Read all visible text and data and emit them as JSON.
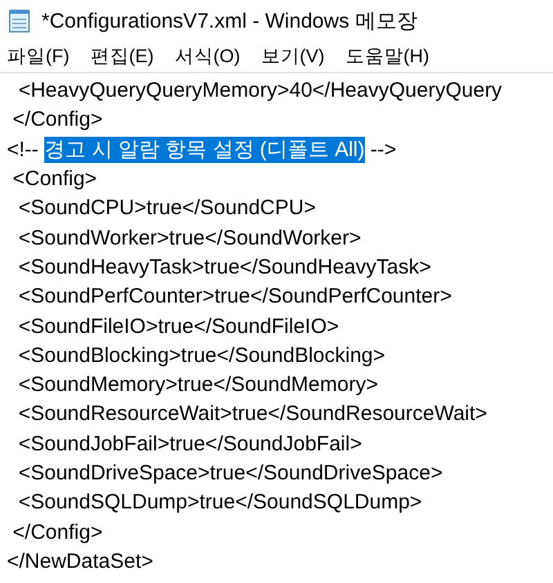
{
  "window": {
    "title": "*ConfigurationsV7.xml - Windows 메모장"
  },
  "menu": [
    "파일(F)",
    "편집(E)",
    "서식(O)",
    "보기(V)",
    "도움말(H)"
  ],
  "editor": {
    "lines": [
      [
        {
          "text": "  <HeavyQueryQueryMemory>40</HeavyQueryQuery",
          "selected": false
        }
      ],
      [
        {
          "text": " </Config>",
          "selected": false
        }
      ],
      [
        {
          "text": "<!-- ",
          "selected": false
        },
        {
          "text": "경고 시 알람 항목 설정 (디폴트 All)",
          "selected": true
        },
        {
          "text": " -->",
          "selected": false
        }
      ],
      [
        {
          "text": " <Config>",
          "selected": false
        }
      ],
      [
        {
          "text": "  <SoundCPU>true</SoundCPU>",
          "selected": false
        }
      ],
      [
        {
          "text": "  <SoundWorker>true</SoundWorker>",
          "selected": false
        }
      ],
      [
        {
          "text": "  <SoundHeavyTask>true</SoundHeavyTask>",
          "selected": false
        }
      ],
      [
        {
          "text": "  <SoundPerfCounter>true</SoundPerfCounter>",
          "selected": false
        }
      ],
      [
        {
          "text": "  <SoundFileIO>true</SoundFileIO>",
          "selected": false
        }
      ],
      [
        {
          "text": "  <SoundBlocking>true</SoundBlocking>",
          "selected": false
        }
      ],
      [
        {
          "text": "  <SoundMemory>true</SoundMemory>",
          "selected": false
        }
      ],
      [
        {
          "text": "  <SoundResourceWait>true</SoundResourceWait>",
          "selected": false
        }
      ],
      [
        {
          "text": "  <SoundJobFail>true</SoundJobFail>",
          "selected": false
        }
      ],
      [
        {
          "text": "  <SoundDriveSpace>true</SoundDriveSpace>",
          "selected": false
        }
      ],
      [
        {
          "text": "  <SoundSQLDump>true</SoundSQLDump>",
          "selected": false
        }
      ],
      [
        {
          "text": " </Config>",
          "selected": false
        }
      ],
      [
        {
          "text": "</NewDataSet>",
          "selected": false
        }
      ]
    ]
  }
}
